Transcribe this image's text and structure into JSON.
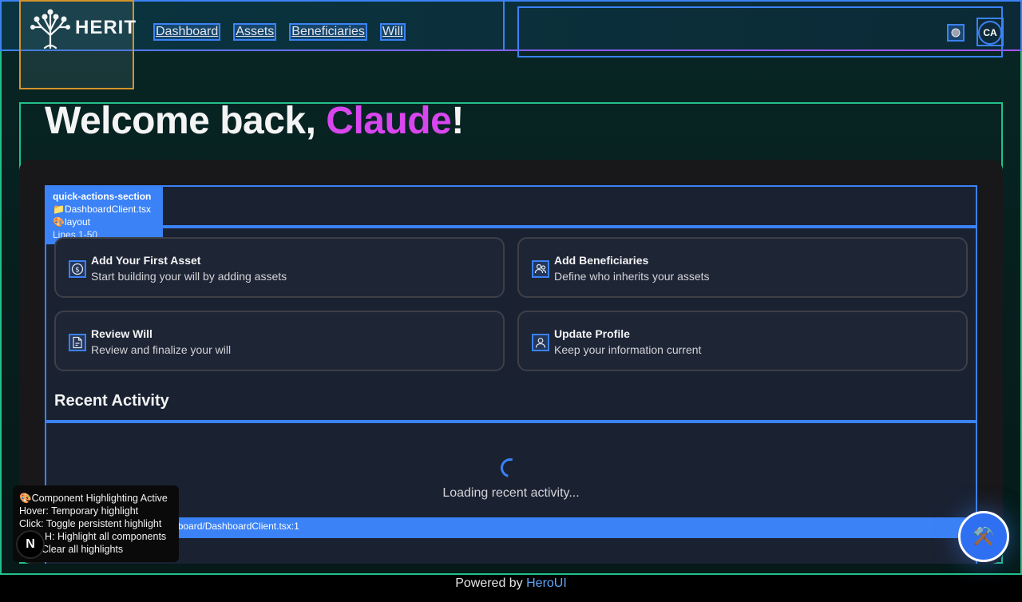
{
  "nav": {
    "brand": "HERIT",
    "links": [
      "Dashboard",
      "Assets",
      "Beneficiaries",
      "Will"
    ],
    "avatar_initials": "CA"
  },
  "welcome": {
    "prefix": "Welcome back, ",
    "name": "Claude",
    "suffix": "!"
  },
  "debug_tag": {
    "section": "quick-actions-section",
    "file": "📁DashboardClient.tsx",
    "kind": "🎨layout",
    "lines": "Lines 1-50"
  },
  "quick_actions": [
    {
      "title": "Add Your First Asset",
      "desc": "Start building your will by adding assets",
      "icon": "dollar-circle-icon"
    },
    {
      "title": "Add Beneficiaries",
      "desc": "Define who inherits your assets",
      "icon": "users-icon"
    },
    {
      "title": "Review Will",
      "desc": "Review and finalize your will",
      "icon": "document-icon"
    },
    {
      "title": "Update Profile",
      "desc": "Keep your information current",
      "icon": "user-icon"
    }
  ],
  "recent": {
    "title": "Recent Activity",
    "loading": "Loading recent activity..."
  },
  "file_path": "ard)/dashboard/DashboardClient.tsx:1",
  "help": {
    "line1": "🎨Component Highlighting Active",
    "line2": "Hover: Temporary highlight",
    "line3": "Click: Toggle persistent highlight",
    "line4": "H: Highlight all components",
    "line5": "Clear all highlights"
  },
  "next_badge": "N",
  "fab_icon": "⚒️",
  "footer": {
    "prefix": "Powered by ",
    "link": "HeroUI"
  },
  "colors": {
    "accent": "#3b82f6",
    "name": "#d946ef",
    "border_green": "#22c08a"
  }
}
